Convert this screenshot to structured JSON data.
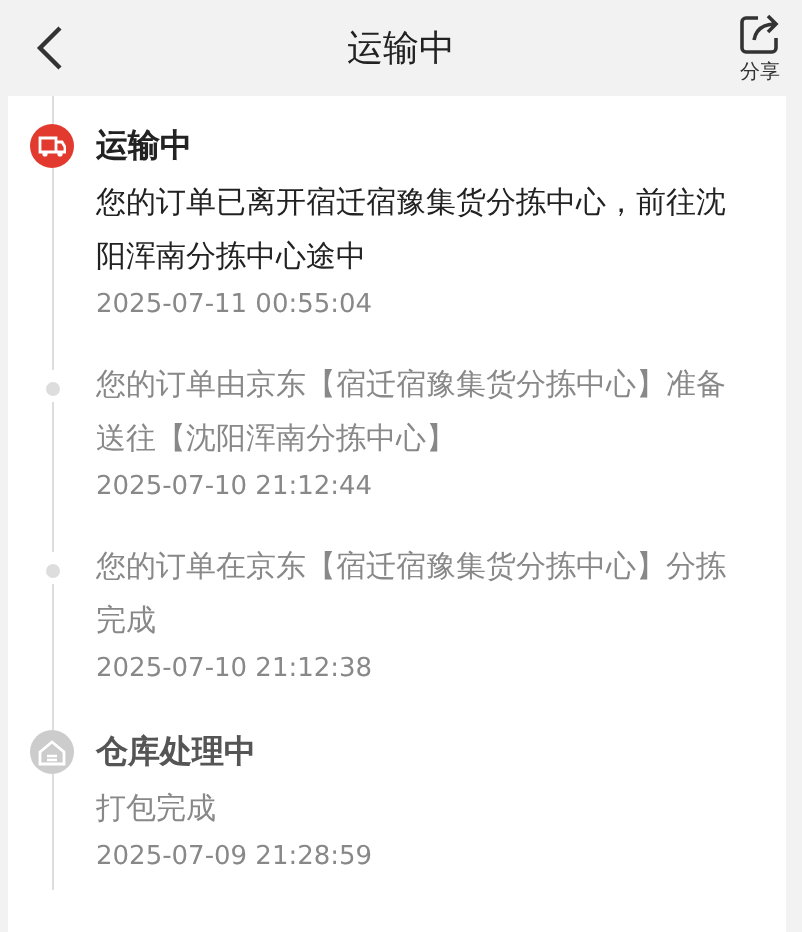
{
  "header": {
    "title": "运输中",
    "share_label": "分享"
  },
  "events": [
    {
      "kind": "stage",
      "active": true,
      "title": "运输中",
      "description": "您的订单已离开宿迁宿豫集货分拣中心，前往沈阳浑南分拣中心途中",
      "time": "2025-07-11 00:55:04"
    },
    {
      "kind": "step",
      "description": "您的订单由京东【宿迁宿豫集货分拣中心】准备送往【沈阳浑南分拣中心】",
      "time": "2025-07-10 21:12:44"
    },
    {
      "kind": "step",
      "description": "您的订单在京东【宿迁宿豫集货分拣中心】分拣完成",
      "time": "2025-07-10 21:12:38"
    },
    {
      "kind": "stage",
      "active": false,
      "title": "仓库处理中",
      "description": "打包完成",
      "time": "2025-07-09 21:28:59"
    }
  ]
}
